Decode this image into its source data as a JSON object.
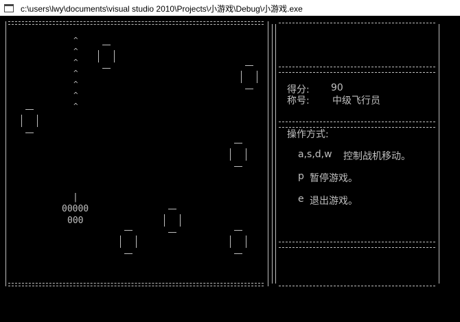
{
  "window": {
    "title": "c:\\users\\lwy\\documents\\visual studio 2010\\Projects\\小游戏\\Debug\\小游戏.exe",
    "icon": "console-window-icon"
  },
  "game": {
    "bullet_char": "^",
    "player": {
      "nose": "|",
      "wings": "00000",
      "tail": "000"
    }
  },
  "status": {
    "score_label": "得分:",
    "score_value": "90",
    "rank_label": "称号:",
    "rank_value": "中级飞行员"
  },
  "help": {
    "heading": "操作方式:",
    "move_keys": "a,s,d,w",
    "move_text": "控制战机移动。",
    "pause_key": "p",
    "pause_text": "暂停游戏。",
    "exit_key": "e",
    "exit_text": "退出游戏。"
  }
}
